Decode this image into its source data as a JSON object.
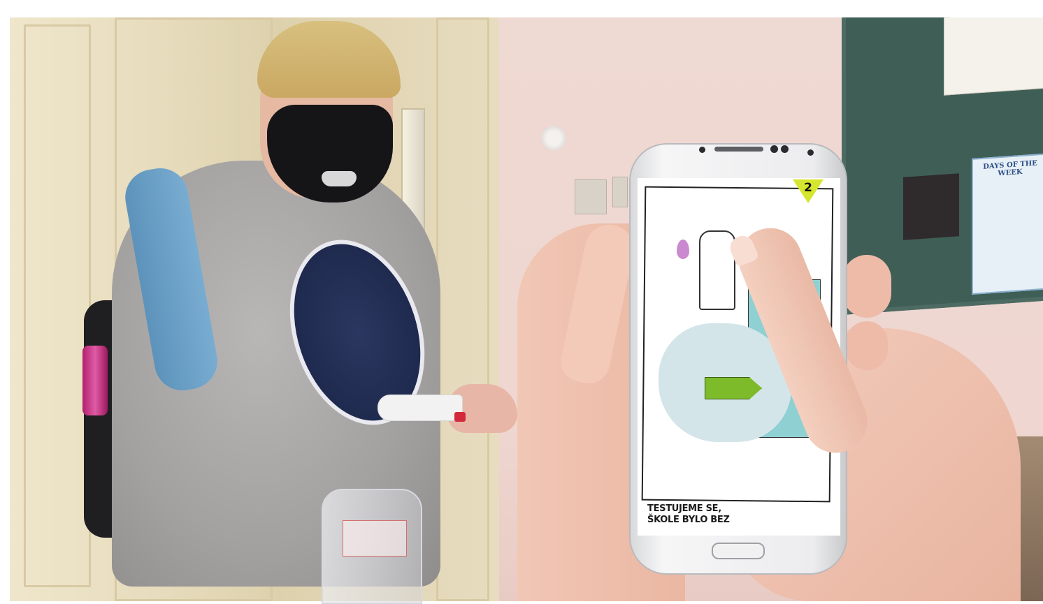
{
  "phone_screen": {
    "step_number": "2",
    "caption_line_1": "TESTUJEME SE,",
    "caption_line_2": "ŠKOLE BYLO BEZ"
  },
  "colors": {
    "badge": "#d6e62e",
    "arrow": "#7dbb2a",
    "teal_panel": "#8fd0d2",
    "cloud": "#d4e5ea",
    "soap_drop": "#c98ad0"
  }
}
